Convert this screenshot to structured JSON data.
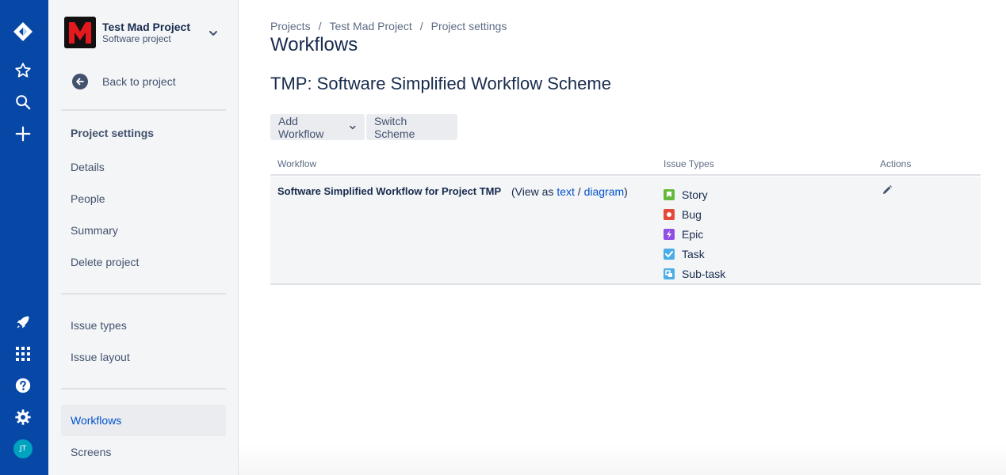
{
  "global_nav": {
    "icons": [
      "jira-logo-icon",
      "star-icon",
      "search-icon",
      "plus-icon",
      "rocket-icon",
      "app-grid-icon",
      "help-icon",
      "gear-icon"
    ],
    "avatar_initials": "JT",
    "color": "#0747a6"
  },
  "project": {
    "name": "Test Mad Project",
    "type": "Software project",
    "back_label": "Back to project"
  },
  "sidebar": {
    "section_title": "Project settings",
    "items": [
      {
        "label": "Details"
      },
      {
        "label": "People"
      },
      {
        "label": "Summary"
      },
      {
        "label": "Delete project"
      },
      {
        "label": "Issue types"
      },
      {
        "label": "Issue layout"
      },
      {
        "label": "Workflows"
      },
      {
        "label": "Screens"
      }
    ],
    "active": "Workflows"
  },
  "breadcrumb": [
    "Projects",
    "Test Mad Project",
    "Project settings"
  ],
  "page_title": "Workflows",
  "scheme_title": "TMP: Software Simplified Workflow Scheme",
  "toolbar": {
    "add_workflow": "Add Workflow",
    "switch_scheme": "Switch Scheme"
  },
  "table": {
    "headers": {
      "workflow": "Workflow",
      "issue_types": "Issue Types",
      "actions": "Actions"
    },
    "row": {
      "workflow_name": "Software Simplified Workflow for Project TMP",
      "view_prefix": "(View as",
      "view_text": "text",
      "view_sep": "/",
      "view_diagram": "diagram",
      "view_suffix": ")",
      "issue_types": [
        {
          "name": "Story",
          "color": "#63ba3c",
          "icon": "story-icon"
        },
        {
          "name": "Bug",
          "color": "#e5493a",
          "icon": "bug-icon"
        },
        {
          "name": "Epic",
          "color": "#904ee2",
          "icon": "epic-icon"
        },
        {
          "name": "Task",
          "color": "#4bade8",
          "icon": "task-icon"
        },
        {
          "name": "Sub-task",
          "color": "#4bade8",
          "icon": "subtask-icon"
        }
      ]
    }
  }
}
